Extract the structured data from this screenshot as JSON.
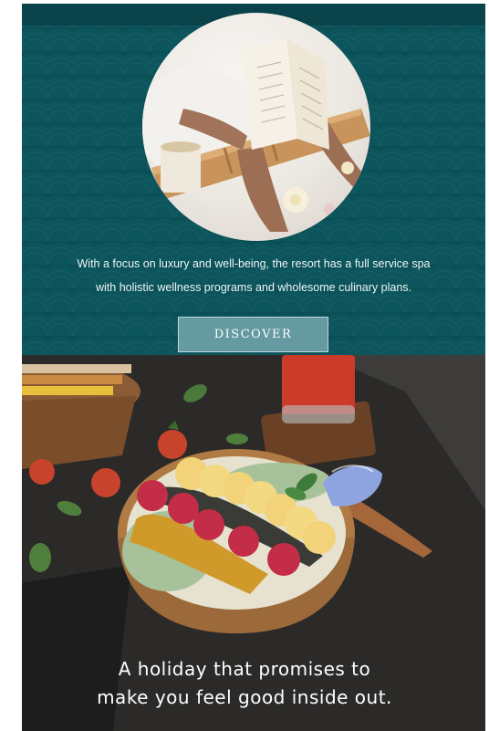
{
  "hero": {
    "image_alt": "Woman reading a book in a bathtub with wooden tray",
    "intro_line_1": "With a focus on luxury and well-being, the resort has a full service spa",
    "intro_line_2": "with holistic wellness programs and wholesome culinary plans.",
    "button_label": "DISCOVER"
  },
  "feature": {
    "image_alt": "Smoothie bowl with banana, dragon fruit and seeds",
    "tagline_line_1": "A holiday that promises to",
    "tagline_line_2": "make you feel good inside out."
  },
  "colors": {
    "teal_background": "#0b4f56",
    "button_background": "#78aab0"
  }
}
